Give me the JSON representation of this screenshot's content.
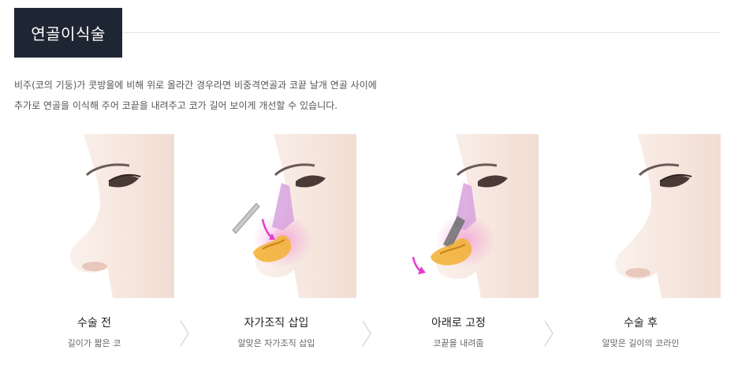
{
  "section": {
    "title": "연골이식술",
    "description": [
      "비주(코의 기둥)가 콧방울에 비해 위로 올라간 경우라면 비중격연골과 코끝 날개 연골 사이에",
      "추가로 연골을 이식해 주어 코끝을 내려주고 코가 길어 보이게 개선할 수 있습니다."
    ]
  },
  "steps": [
    {
      "title": "수술 전",
      "subtitle": "길이가 짧은 코"
    },
    {
      "title": "자가조직 삽입",
      "subtitle": "알맞은 자가조직 삽입"
    },
    {
      "title": "아래로 고정",
      "subtitle": "코끝을 내려줌"
    },
    {
      "title": "수술 후",
      "subtitle": "알맞은 길이의 코라인"
    }
  ],
  "colors": {
    "title_bg": "#1f2633",
    "skin": "#f6e6dd",
    "cartilage_purple": "#d9a6df",
    "cartilage_yellow": "#f2b43a",
    "arrow_magenta": "#e23ccf"
  },
  "icons": [
    "chevron-right-icon"
  ]
}
